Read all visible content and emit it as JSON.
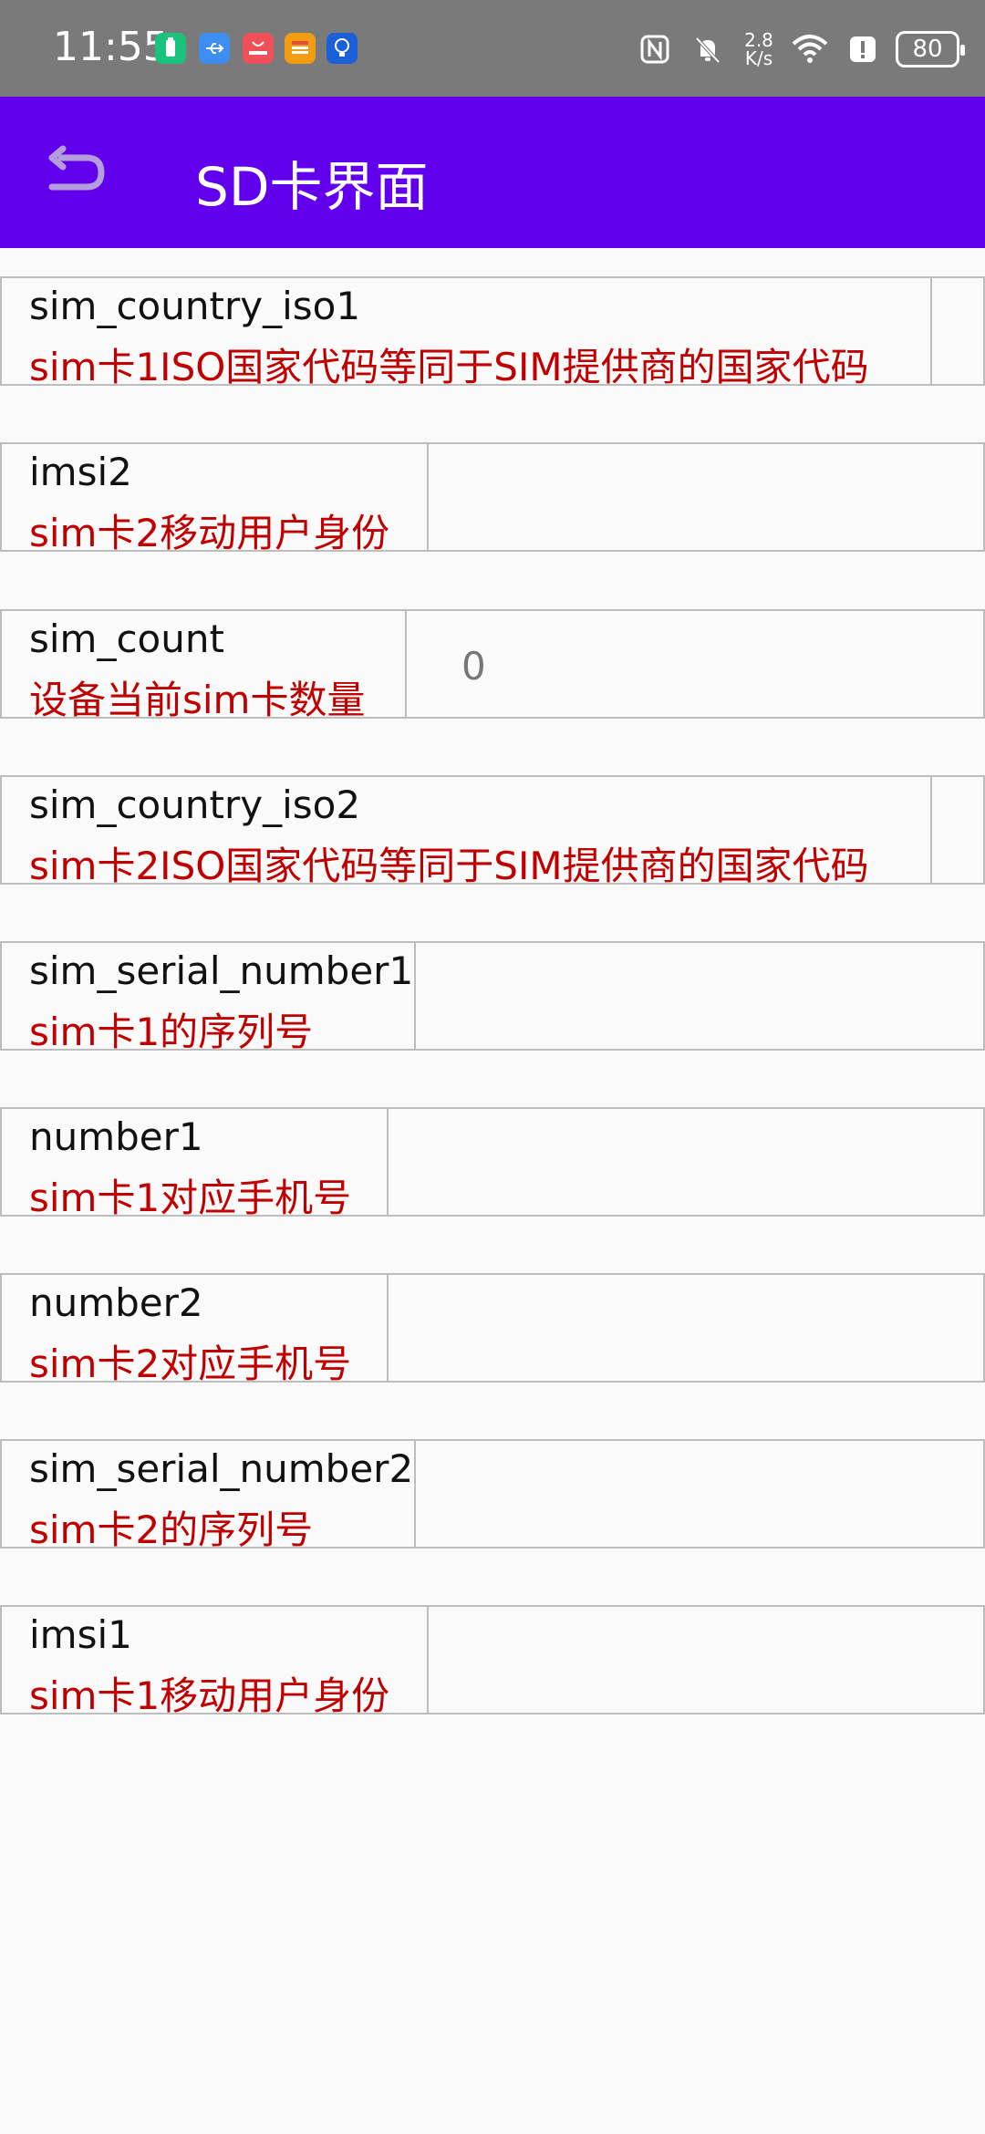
{
  "status_bar": {
    "time": "11:55",
    "network_speed_value": "2.8",
    "network_speed_unit": "K/s",
    "battery_level": "80",
    "notification_icons": [
      "battery-app-icon",
      "usb-icon",
      "huawei-app-icon",
      "calendar-app-icon",
      "tips-app-icon"
    ],
    "status_icons": [
      "nfc-icon",
      "mute-icon",
      "wifi-icon",
      "alert-icon"
    ]
  },
  "app_bar": {
    "title": "SD卡界面",
    "back_icon": "back-arrow-icon",
    "background_color": "#6200ee"
  },
  "colors": {
    "key_text": "#111111",
    "desc_text": "#c00000",
    "border": "#bdbdbd",
    "value_text": "#777777"
  },
  "rows": [
    {
      "key": "sim_country_iso1",
      "desc": "sim卡1ISO国家代码等同于SIM提供商的国家代码",
      "value": ""
    },
    {
      "key": "imsi2",
      "desc": "sim卡2移动用户身份",
      "value": ""
    },
    {
      "key": "sim_count",
      "desc": "设备当前sim卡数量",
      "value": "0"
    },
    {
      "key": "sim_country_iso2",
      "desc": "sim卡2ISO国家代码等同于SIM提供商的国家代码",
      "value": ""
    },
    {
      "key": "sim_serial_number1",
      "desc": "sim卡1的序列号",
      "value": ""
    },
    {
      "key": "number1",
      "desc": "sim卡1对应手机号",
      "value": ""
    },
    {
      "key": "number2",
      "desc": "sim卡2对应手机号",
      "value": ""
    },
    {
      "key": "sim_serial_number2",
      "desc": "sim卡2的序列号",
      "value": ""
    },
    {
      "key": "imsi1",
      "desc": "sim卡1移动用户身份",
      "value": ""
    }
  ]
}
